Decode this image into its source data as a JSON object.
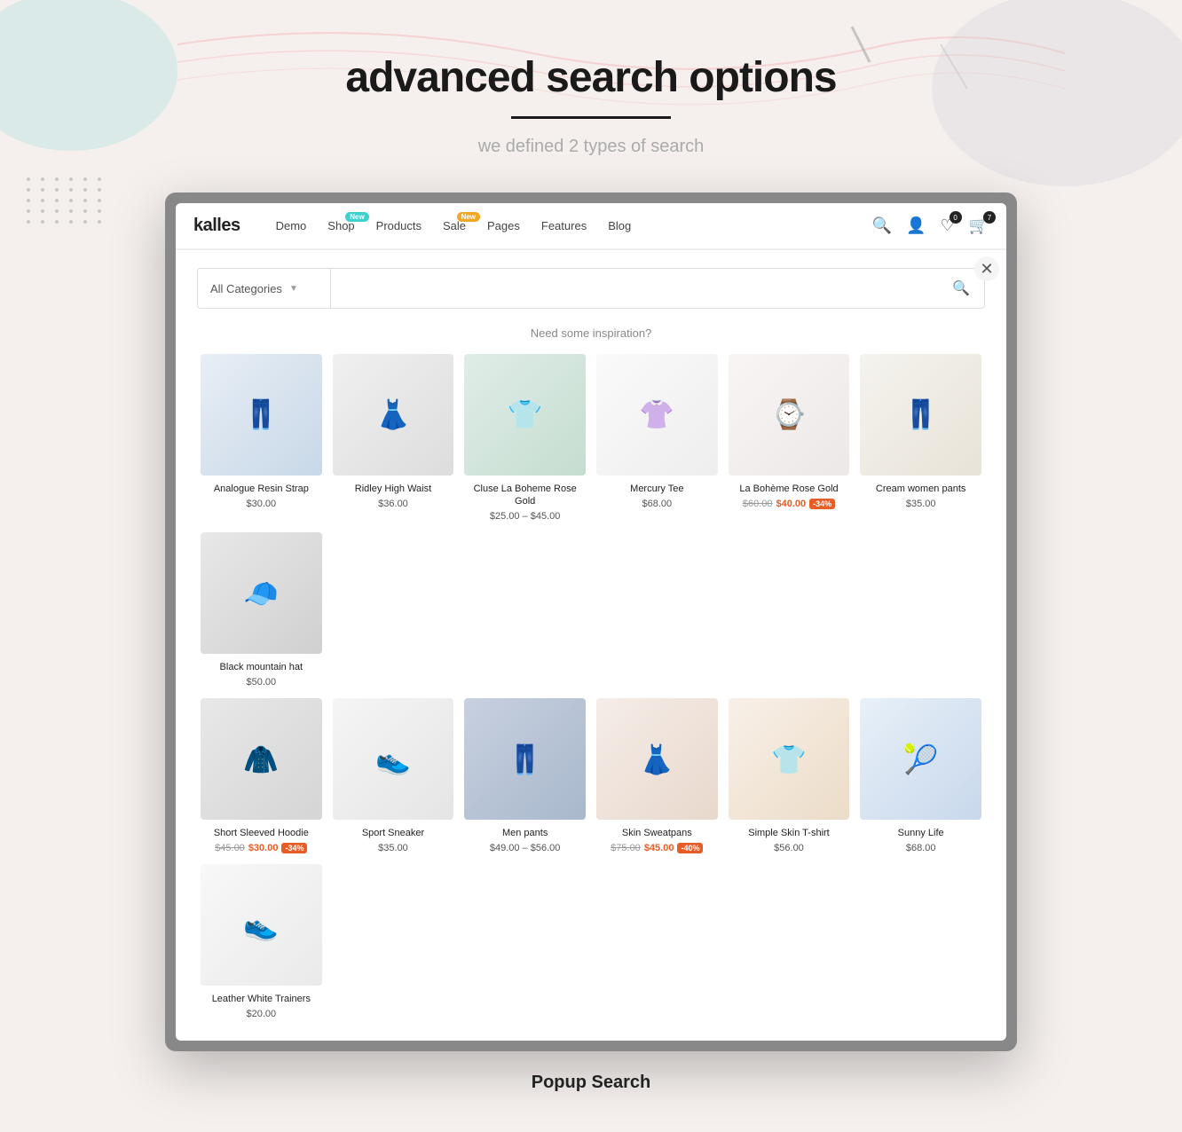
{
  "page": {
    "title": "advanced search  options",
    "underline": true,
    "subtitle": "we defined 2 types of search",
    "popup_label": "Popup Search"
  },
  "navbar": {
    "logo": "kalles",
    "items": [
      {
        "label": "Demo",
        "badge": null
      },
      {
        "label": "Shop",
        "badge": {
          "text": "New",
          "color": "teal"
        }
      },
      {
        "label": "Products",
        "badge": null
      },
      {
        "label": "Sale",
        "badge": {
          "text": "New",
          "color": "orange"
        }
      },
      {
        "label": "Pages",
        "badge": null
      },
      {
        "label": "Features",
        "badge": null
      },
      {
        "label": "Blog",
        "badge": null
      }
    ],
    "icons": {
      "search": "🔍",
      "user": "👤",
      "wishlist": "♡",
      "cart": "🛒",
      "cart_badge": "7",
      "wishlist_badge": "0"
    }
  },
  "search": {
    "category_placeholder": "All Categories",
    "input_placeholder": "",
    "inspiration_label": "Need some inspiration?"
  },
  "products_row1": [
    {
      "name": "Analogue Resin Strap",
      "price_display": "$30.00",
      "price_type": "single",
      "img_class": "img-blue-pants",
      "emoji": "👖"
    },
    {
      "name": "Ridley High Waist",
      "price_display": "$36.00",
      "price_type": "single",
      "img_class": "img-black-pants",
      "emoji": "👗"
    },
    {
      "name": "Cluse La Boheme Rose Gold",
      "price_display": "$25.00 – $45.00",
      "price_type": "range",
      "img_class": "img-green-tee",
      "emoji": "👕"
    },
    {
      "name": "Mercury Tee",
      "price_display": "$68.00",
      "price_type": "single",
      "img_class": "img-white-top",
      "emoji": "👚"
    },
    {
      "name": "La Bohème Rose Gold",
      "price_old": "$60.00",
      "price_new": "$40.00",
      "discount": "-34%",
      "price_type": "sale",
      "img_class": "img-watch",
      "emoji": "⌚"
    },
    {
      "name": "Cream women pants",
      "price_display": "$35.00",
      "price_type": "single",
      "img_class": "img-cream-pants",
      "emoji": "👖"
    },
    {
      "name": "Black mountain hat",
      "price_display": "$50.00",
      "price_type": "single",
      "img_class": "img-black-hat",
      "emoji": "🧢"
    }
  ],
  "products_row2": [
    {
      "name": "Short Sleeved Hoodie",
      "price_old": "$45.00",
      "price_new": "$30.00",
      "discount": "-34%",
      "price_type": "sale",
      "img_class": "img-grey-hoodie",
      "emoji": "🧥"
    },
    {
      "name": "Sport Sneaker",
      "price_display": "$35.00",
      "price_type": "single",
      "img_class": "img-white-sneaker",
      "emoji": "👟"
    },
    {
      "name": "Men pants",
      "price_display": "$49.00 – $56.00",
      "price_type": "range",
      "img_class": "img-jeans",
      "emoji": "👖"
    },
    {
      "name": "Skin Sweatpans",
      "price_old": "$75.00",
      "price_new": "$45.00",
      "discount": "-40%",
      "price_type": "sale",
      "img_class": "img-skin-sweat",
      "emoji": "👗"
    },
    {
      "name": "Simple Skin T-shirt",
      "price_display": "$56.00",
      "price_type": "single",
      "img_class": "img-skin-tshirt",
      "emoji": "👕"
    },
    {
      "name": "Sunny Life",
      "price_display": "$68.00",
      "price_type": "single",
      "img_class": "img-sunny-life",
      "emoji": "🎾"
    },
    {
      "name": "Leather White Trainers",
      "price_display": "$20.00",
      "price_type": "single",
      "img_class": "img-white-trainers",
      "emoji": "👟"
    }
  ]
}
